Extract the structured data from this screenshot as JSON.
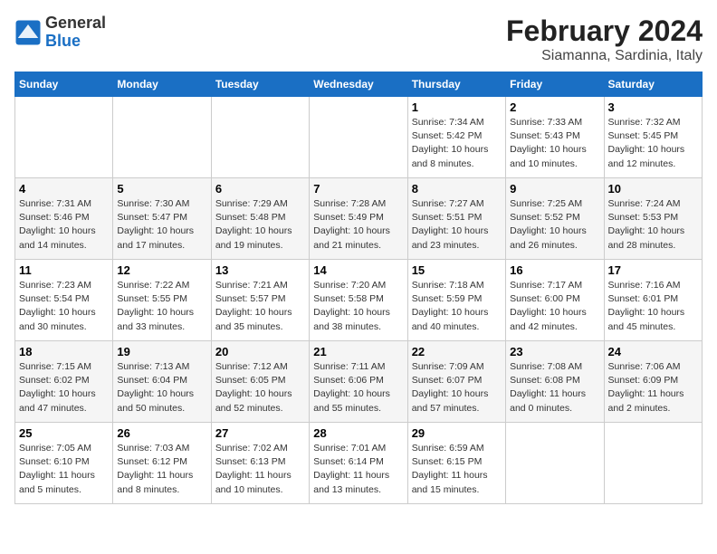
{
  "logo": {
    "general": "General",
    "blue": "Blue"
  },
  "title": "February 2024",
  "subtitle": "Siamanna, Sardinia, Italy",
  "days_header": [
    "Sunday",
    "Monday",
    "Tuesday",
    "Wednesday",
    "Thursday",
    "Friday",
    "Saturday"
  ],
  "weeks": [
    [
      {
        "day": "",
        "info": ""
      },
      {
        "day": "",
        "info": ""
      },
      {
        "day": "",
        "info": ""
      },
      {
        "day": "",
        "info": ""
      },
      {
        "day": "1",
        "info": "Sunrise: 7:34 AM\nSunset: 5:42 PM\nDaylight: 10 hours\nand 8 minutes."
      },
      {
        "day": "2",
        "info": "Sunrise: 7:33 AM\nSunset: 5:43 PM\nDaylight: 10 hours\nand 10 minutes."
      },
      {
        "day": "3",
        "info": "Sunrise: 7:32 AM\nSunset: 5:45 PM\nDaylight: 10 hours\nand 12 minutes."
      }
    ],
    [
      {
        "day": "4",
        "info": "Sunrise: 7:31 AM\nSunset: 5:46 PM\nDaylight: 10 hours\nand 14 minutes."
      },
      {
        "day": "5",
        "info": "Sunrise: 7:30 AM\nSunset: 5:47 PM\nDaylight: 10 hours\nand 17 minutes."
      },
      {
        "day": "6",
        "info": "Sunrise: 7:29 AM\nSunset: 5:48 PM\nDaylight: 10 hours\nand 19 minutes."
      },
      {
        "day": "7",
        "info": "Sunrise: 7:28 AM\nSunset: 5:49 PM\nDaylight: 10 hours\nand 21 minutes."
      },
      {
        "day": "8",
        "info": "Sunrise: 7:27 AM\nSunset: 5:51 PM\nDaylight: 10 hours\nand 23 minutes."
      },
      {
        "day": "9",
        "info": "Sunrise: 7:25 AM\nSunset: 5:52 PM\nDaylight: 10 hours\nand 26 minutes."
      },
      {
        "day": "10",
        "info": "Sunrise: 7:24 AM\nSunset: 5:53 PM\nDaylight: 10 hours\nand 28 minutes."
      }
    ],
    [
      {
        "day": "11",
        "info": "Sunrise: 7:23 AM\nSunset: 5:54 PM\nDaylight: 10 hours\nand 30 minutes."
      },
      {
        "day": "12",
        "info": "Sunrise: 7:22 AM\nSunset: 5:55 PM\nDaylight: 10 hours\nand 33 minutes."
      },
      {
        "day": "13",
        "info": "Sunrise: 7:21 AM\nSunset: 5:57 PM\nDaylight: 10 hours\nand 35 minutes."
      },
      {
        "day": "14",
        "info": "Sunrise: 7:20 AM\nSunset: 5:58 PM\nDaylight: 10 hours\nand 38 minutes."
      },
      {
        "day": "15",
        "info": "Sunrise: 7:18 AM\nSunset: 5:59 PM\nDaylight: 10 hours\nand 40 minutes."
      },
      {
        "day": "16",
        "info": "Sunrise: 7:17 AM\nSunset: 6:00 PM\nDaylight: 10 hours\nand 42 minutes."
      },
      {
        "day": "17",
        "info": "Sunrise: 7:16 AM\nSunset: 6:01 PM\nDaylight: 10 hours\nand 45 minutes."
      }
    ],
    [
      {
        "day": "18",
        "info": "Sunrise: 7:15 AM\nSunset: 6:02 PM\nDaylight: 10 hours\nand 47 minutes."
      },
      {
        "day": "19",
        "info": "Sunrise: 7:13 AM\nSunset: 6:04 PM\nDaylight: 10 hours\nand 50 minutes."
      },
      {
        "day": "20",
        "info": "Sunrise: 7:12 AM\nSunset: 6:05 PM\nDaylight: 10 hours\nand 52 minutes."
      },
      {
        "day": "21",
        "info": "Sunrise: 7:11 AM\nSunset: 6:06 PM\nDaylight: 10 hours\nand 55 minutes."
      },
      {
        "day": "22",
        "info": "Sunrise: 7:09 AM\nSunset: 6:07 PM\nDaylight: 10 hours\nand 57 minutes."
      },
      {
        "day": "23",
        "info": "Sunrise: 7:08 AM\nSunset: 6:08 PM\nDaylight: 11 hours\nand 0 minutes."
      },
      {
        "day": "24",
        "info": "Sunrise: 7:06 AM\nSunset: 6:09 PM\nDaylight: 11 hours\nand 2 minutes."
      }
    ],
    [
      {
        "day": "25",
        "info": "Sunrise: 7:05 AM\nSunset: 6:10 PM\nDaylight: 11 hours\nand 5 minutes."
      },
      {
        "day": "26",
        "info": "Sunrise: 7:03 AM\nSunset: 6:12 PM\nDaylight: 11 hours\nand 8 minutes."
      },
      {
        "day": "27",
        "info": "Sunrise: 7:02 AM\nSunset: 6:13 PM\nDaylight: 11 hours\nand 10 minutes."
      },
      {
        "day": "28",
        "info": "Sunrise: 7:01 AM\nSunset: 6:14 PM\nDaylight: 11 hours\nand 13 minutes."
      },
      {
        "day": "29",
        "info": "Sunrise: 6:59 AM\nSunset: 6:15 PM\nDaylight: 11 hours\nand 15 minutes."
      },
      {
        "day": "",
        "info": ""
      },
      {
        "day": "",
        "info": ""
      }
    ]
  ]
}
